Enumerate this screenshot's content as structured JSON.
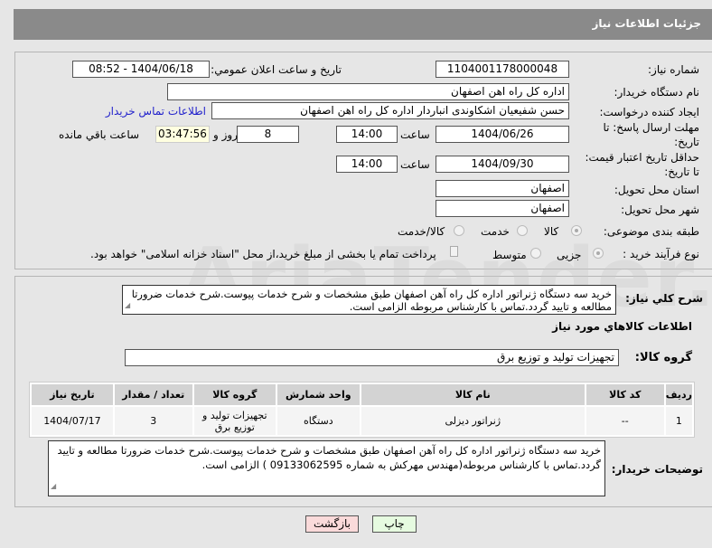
{
  "header": {
    "title": "جزئیات اطلاعات نیاز"
  },
  "watermark": "AriaTender.net",
  "fields": {
    "need_number_label": "شماره نیاز:",
    "need_number": "1104001178000048",
    "announce_label": "تاریخ و ساعت اعلان عمومي:",
    "announce_value": "1404/06/18 - 08:52",
    "buyer_org_label": "نام دستگاه خریدار:",
    "buyer_org": "اداره کل راه اهن اصفهان",
    "creator_label": "ایجاد کننده درخواست:",
    "creator": "حسن شفیعیان اشکاوندی انباردار اداره کل راه اهن اصفهان",
    "contact_link": "اطلاعات تماس خریدار",
    "deadline_label": "مهلت ارسال پاسخ: تا تاریخ:",
    "deadline_date": "1404/06/26",
    "time_label": "ساعت",
    "deadline_time": "14:00",
    "days": "8",
    "days_label": "روز و",
    "remaining": "03:47:56",
    "remaining_label": "ساعت باقي مانده",
    "validity_label": "حداقل تاریخ اعتبار قیمت: تا تاریخ:",
    "validity_date": "1404/09/30",
    "validity_time": "14:00",
    "province_label": "استان محل تحویل:",
    "province": "اصفهان",
    "city_label": "شهر محل تحویل:",
    "city": "اصفهان",
    "category_label": "طبقه بندی موضوعی:",
    "category_options": [
      "کالا",
      "خدمت",
      "کالا/خدمت"
    ],
    "process_label": "نوع فرآیند خرید :",
    "process_options": [
      "جزیی",
      "متوسط"
    ],
    "payment_note": "پرداخت تمام یا بخشی از مبلغ خرید،از محل \"اسناد خزانه اسلامی\" خواهد بود."
  },
  "summary": {
    "label": "شرح کلي نیاز:",
    "text": "خرید سه دستگاه ژنراتور اداره کل راه آهن اصفهان طبق مشخصات و شرح خدمات پیوست.شرح خدمات ضرورتا مطالعه و تایید گردد.تماس با کارشناس مربوطه الزامی است."
  },
  "goods": {
    "heading": "اطلاعات کالاهاي مورد نیاز",
    "group_label": "گروه کالا:",
    "group": "تجهیزات تولید و توزیع برق",
    "columns": [
      "ردیف",
      "کد کالا",
      "نام کالا",
      "واحد شمارش",
      "گروه کالا",
      "تعداد / مقدار",
      "تاریخ نیاز"
    ],
    "rows": [
      [
        "1",
        "--",
        "ژنراتور دیزلی",
        "دستگاه",
        "تجهیزات تولید و توزیع برق",
        "3",
        "1404/07/17"
      ]
    ]
  },
  "notes": {
    "label": "توضیحات خریدار:",
    "text": "خرید سه دستگاه ژنراتور اداره کل راه آهن اصفهان طبق مشخصات و شرح خدمات پیوست.شرح خدمات ضرورتا مطالعه و تایید گردد.تماس با کارشناس مربوطه(مهندس مهرکش به شماره 09133062595 ) الزامی است."
  },
  "buttons": {
    "back": "بازگشت",
    "print": "چاپ"
  }
}
